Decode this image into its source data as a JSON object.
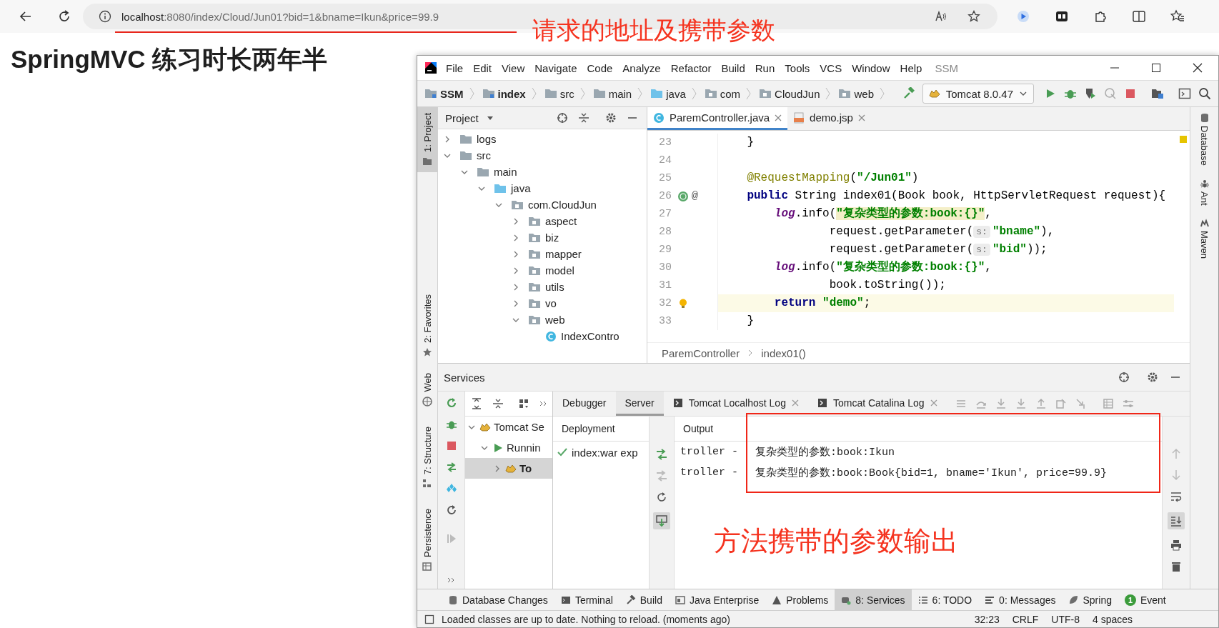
{
  "browser": {
    "address": {
      "host": "localhost",
      "rest": ":8080/index/Cloud/Jun01?bid=1&bname=Ikun&price=99.9"
    }
  },
  "page": {
    "heading": "SpringMVC 练习时长两年半"
  },
  "annotations": [
    {
      "kind": "url_note",
      "text": "请求的地址及携带参数"
    },
    {
      "kind": "output_note",
      "text": "方法携带的参数输出"
    }
  ],
  "ide": {
    "menu": [
      "File",
      "Edit",
      "View",
      "Navigate",
      "Code",
      "Analyze",
      "Refactor",
      "Build",
      "Run",
      "Tools",
      "VCS",
      "Window",
      "Help"
    ],
    "project_name": "SSM",
    "breadcrumbs": [
      {
        "label": "SSM",
        "kind": "module",
        "bold": true
      },
      {
        "label": "index",
        "kind": "module",
        "bold": true
      },
      {
        "label": "src",
        "kind": "folder",
        "bold": false
      },
      {
        "label": "main",
        "kind": "folder",
        "bold": false
      },
      {
        "label": "java",
        "kind": "source",
        "bold": false
      },
      {
        "label": "com",
        "kind": "package",
        "bold": false
      },
      {
        "label": "CloudJun",
        "kind": "package",
        "bold": false
      },
      {
        "label": "web",
        "kind": "package",
        "bold": false
      }
    ],
    "run_config": "Tomcat 8.0.47",
    "left_stripe": {
      "top": [
        {
          "label": "1: Project",
          "kind": "project",
          "selected": true
        }
      ],
      "bottom": [
        {
          "label": "2: Favorites",
          "kind": "favorites",
          "selected": false
        }
      ],
      "services": [
        {
          "label": "Web",
          "kind": "web",
          "selected": false
        },
        {
          "label": "7: Structure",
          "kind": "structure",
          "selected": false
        },
        {
          "label": "Persistence",
          "kind": "persistence",
          "selected": false
        }
      ]
    },
    "right_stripe": [
      {
        "label": "Database",
        "kind": "database"
      },
      {
        "label": "Ant",
        "kind": "ant"
      },
      {
        "label": "Maven",
        "kind": "maven"
      }
    ],
    "project": {
      "title": "Project",
      "tree": [
        {
          "label": "logs",
          "kind": "folder",
          "expanded": false
        },
        {
          "label": "src",
          "kind": "folder",
          "expanded": true,
          "children": [
            {
              "label": "main",
              "kind": "folder",
              "expanded": true,
              "children": [
                {
                  "label": "java",
                  "kind": "source",
                  "expanded": true,
                  "children": [
                    {
                      "label": "com.CloudJun",
                      "kind": "package",
                      "expanded": true,
                      "children": [
                        {
                          "label": "aspect",
                          "kind": "package",
                          "expanded": false
                        },
                        {
                          "label": "biz",
                          "kind": "package",
                          "expanded": false
                        },
                        {
                          "label": "mapper",
                          "kind": "package",
                          "expanded": false
                        },
                        {
                          "label": "model",
                          "kind": "package",
                          "expanded": false
                        },
                        {
                          "label": "utils",
                          "kind": "package",
                          "expanded": false
                        },
                        {
                          "label": "vo",
                          "kind": "package",
                          "expanded": false
                        },
                        {
                          "label": "web",
                          "kind": "package",
                          "expanded": true,
                          "children": [
                            {
                              "label": "IndexContro",
                              "kind": "class"
                            }
                          ]
                        }
                      ]
                    }
                  ]
                }
              ]
            }
          ]
        }
      ]
    },
    "editor": {
      "tabs": [
        {
          "label": "ParemController.java",
          "kind": "java",
          "selected": true
        },
        {
          "label": "demo.jsp",
          "kind": "jsp",
          "selected": false
        }
      ],
      "lines": [
        {
          "number": "23",
          "kind": "plain",
          "current": false,
          "tokens": [
            {
              "kind": "plain",
              "text": "    }"
            }
          ]
        },
        {
          "number": "24",
          "kind": "plain",
          "current": false
        },
        {
          "number": "25",
          "kind": "plain",
          "current": false,
          "tokens": [
            {
              "kind": "annotation",
              "text": "    @RequestMapping"
            },
            {
              "kind": "plain",
              "text": "("
            },
            {
              "kind": "string",
              "text": "\"/Jun01\""
            },
            {
              "kind": "plain",
              "text": ")"
            }
          ]
        },
        {
          "number": "26",
          "kind": "web",
          "current": false,
          "gutter_symbol": "@",
          "tokens": [
            {
              "kind": "keyword",
              "text": "    public"
            },
            {
              "kind": "plain",
              "text": " String index01(Book book, HttpServletRequest request){"
            }
          ]
        },
        {
          "number": "27",
          "kind": "plain",
          "current": false,
          "tokens": [
            {
              "kind": "field",
              "text": "        log"
            },
            {
              "kind": "plain",
              "text": ".info("
            },
            {
              "kind": "string_hl",
              "text": "\"复杂类型的参数:book:{}\""
            },
            {
              "kind": "plain",
              "text": ","
            }
          ]
        },
        {
          "number": "28",
          "kind": "plain",
          "current": false,
          "tokens": [
            {
              "kind": "plain",
              "text": "                request.getParameter("
            },
            {
              "kind": "hint",
              "text": "s:"
            },
            {
              "kind": "string",
              "text": "\"bname\""
            },
            {
              "kind": "plain",
              "text": "),"
            }
          ]
        },
        {
          "number": "29",
          "kind": "plain",
          "current": false,
          "tokens": [
            {
              "kind": "plain",
              "text": "                request.getParameter("
            },
            {
              "kind": "hint",
              "text": "s:"
            },
            {
              "kind": "string",
              "text": "\"bid\""
            },
            {
              "kind": "plain",
              "text": "));"
            }
          ]
        },
        {
          "number": "30",
          "kind": "plain",
          "current": false,
          "tokens": [
            {
              "kind": "field",
              "text": "        log"
            },
            {
              "kind": "plain",
              "text": ".info("
            },
            {
              "kind": "string",
              "text": "\"复杂类型的参数:book:{}\""
            },
            {
              "kind": "plain",
              "text": ","
            }
          ]
        },
        {
          "number": "31",
          "kind": "plain",
          "current": false,
          "tokens": [
            {
              "kind": "plain",
              "text": "                book.toString());"
            }
          ]
        },
        {
          "number": "32",
          "kind": "bulb",
          "current": true,
          "tokens": [
            {
              "kind": "keyword",
              "text": "        return "
            },
            {
              "kind": "string",
              "text": "\"demo\""
            },
            {
              "kind": "plain",
              "text": ";"
            }
          ]
        },
        {
          "number": "33",
          "kind": "plain",
          "current": false,
          "tokens": [
            {
              "kind": "plain",
              "text": "    }"
            }
          ]
        }
      ],
      "breadcrumb": [
        "ParemController",
        "index01()"
      ]
    },
    "services": {
      "title": "Services",
      "tree": [
        {
          "label": "Tomcat Se",
          "kind": "server",
          "expanded": true,
          "selected": false,
          "children": [
            {
              "label": "Runnin",
              "kind": "running",
              "expanded": true,
              "selected": false,
              "children": [
                {
                  "label": "To",
                  "kind": "server",
                  "expanded": false,
                  "selected": true
                }
              ]
            }
          ]
        }
      ],
      "tabs": [
        {
          "label": "Debugger",
          "selected": false,
          "closable": false
        },
        {
          "label": "Server",
          "selected": true,
          "closable": false
        },
        {
          "label": "Tomcat Localhost Log",
          "selected": false,
          "closable": true
        },
        {
          "label": "Tomcat Catalina Log",
          "selected": false,
          "closable": true
        }
      ],
      "deployment": {
        "header": "Deployment",
        "items": [
          "index:war exp"
        ]
      },
      "output": {
        "header": "Output",
        "lines": [
          {
            "source": "troller -",
            "message": "复杂类型的参数:book:Ikun"
          },
          {
            "source": "troller -",
            "message": "复杂类型的参数:book:Book{bid=1, bname='Ikun', price=99.9}"
          }
        ]
      }
    },
    "tool_tabs": [
      {
        "label": "Database Changes",
        "kind": "db",
        "selected": false
      },
      {
        "label": "Terminal",
        "kind": "terminal",
        "selected": false
      },
      {
        "label": "Build",
        "kind": "build",
        "selected": false
      },
      {
        "label": "Java Enterprise",
        "kind": "javaee",
        "selected": false
      },
      {
        "label": "Problems",
        "kind": "problems",
        "selected": false
      },
      {
        "label": "8: Services",
        "kind": "services",
        "selected": true
      },
      {
        "label": "6: TODO",
        "kind": "todo",
        "selected": false
      },
      {
        "label": "0: Messages",
        "kind": "messages",
        "selected": false
      },
      {
        "label": "Spring",
        "kind": "spring",
        "selected": false
      },
      {
        "label": "Event",
        "kind": "event",
        "selected": false,
        "badge": "1"
      }
    ],
    "status": {
      "message": "Loaded classes are up to date. Nothing to reload. (moments ago)",
      "position": "32:23",
      "line_separator": "CRLF",
      "encoding": "UTF-8",
      "indent": "4 spaces"
    }
  }
}
